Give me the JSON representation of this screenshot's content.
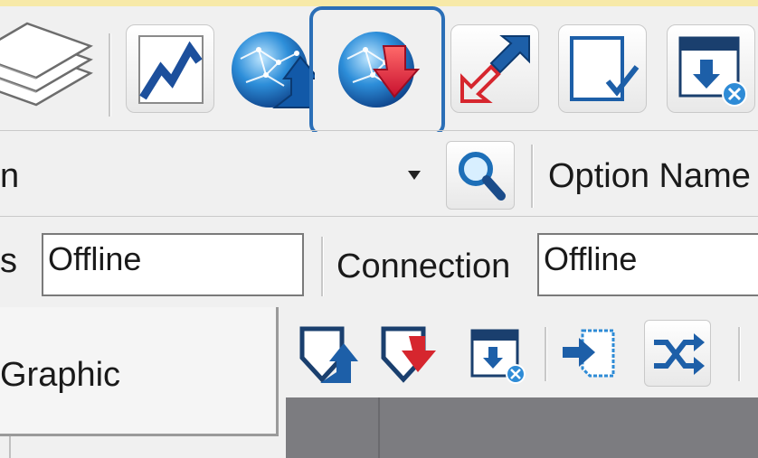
{
  "toolbar_main": {
    "buttons": [
      {
        "name": "stack-icon"
      },
      {
        "name": "trend-chart-icon"
      },
      {
        "name": "globe-upload-icon"
      },
      {
        "name": "globe-download-icon",
        "selected": true
      },
      {
        "name": "swap-arrows-icon"
      },
      {
        "name": "document-check-icon"
      },
      {
        "name": "window-download-icon"
      }
    ],
    "accent_color": "#2b6fb7"
  },
  "search_row": {
    "left_text": "n",
    "dropdown_icon": "triangle-down-icon",
    "search_icon": "magnifier-icon",
    "option_name_label": "Option Name"
  },
  "status_row": {
    "status_label_fragment": "s",
    "status_value": "Offline",
    "connection_label": "Connection",
    "connection_value": "Offline"
  },
  "left_panel": {
    "tab_label": "Graphic"
  },
  "toolbar_secondary": {
    "buttons": [
      {
        "name": "shield-upload-icon"
      },
      {
        "name": "shield-download-icon"
      },
      {
        "name": "window-download-small-icon"
      },
      {
        "name": "import-document-icon"
      },
      {
        "name": "shuffle-icon"
      }
    ]
  }
}
